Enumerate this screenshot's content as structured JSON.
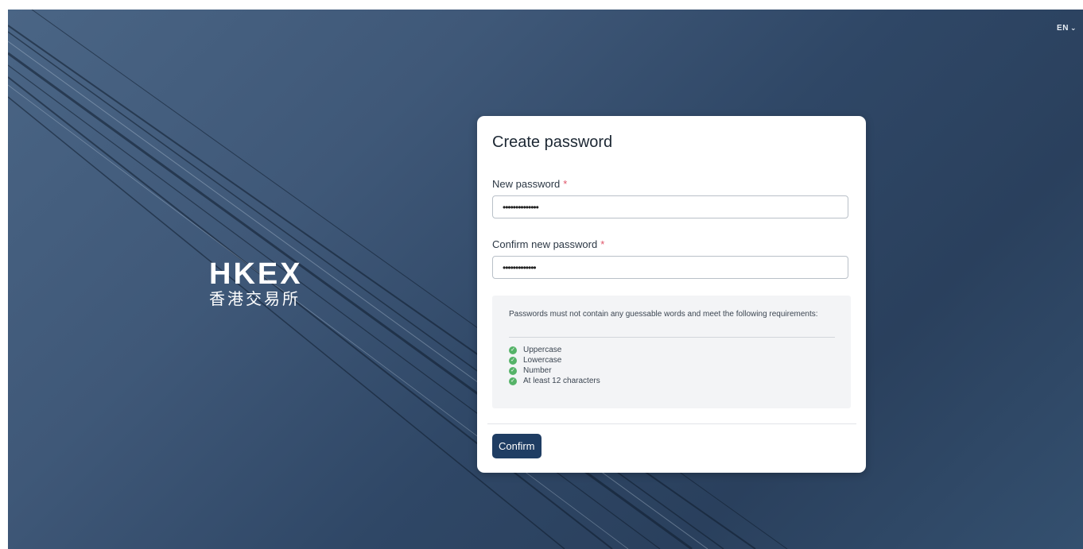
{
  "header": {
    "language": "EN",
    "language_icon": "chevron-down-icon"
  },
  "logo": {
    "name": "HKEX",
    "chinese": "香港交易所"
  },
  "form": {
    "title": "Create password",
    "new_password": {
      "label": "New password",
      "required_mark": "*",
      "value": "••••••••••••••"
    },
    "confirm_password": {
      "label": "Confirm new password",
      "required_mark": "*",
      "value": "•••••••••••••"
    },
    "requirements": {
      "intro": "Passwords must not contain any guessable words and meet the following requirements:",
      "items": [
        {
          "label": "Uppercase",
          "met": true
        },
        {
          "label": "Lowercase",
          "met": true
        },
        {
          "label": "Number",
          "met": true
        },
        {
          "label": "At least 12 characters",
          "met": true
        }
      ],
      "check_icon": "check-circle-icon"
    },
    "confirm_label": "Confirm"
  },
  "colors": {
    "primary_button": "#1f3d63",
    "required_star": "#e0566a",
    "check_green": "#55b368",
    "background": "#3a5272"
  }
}
